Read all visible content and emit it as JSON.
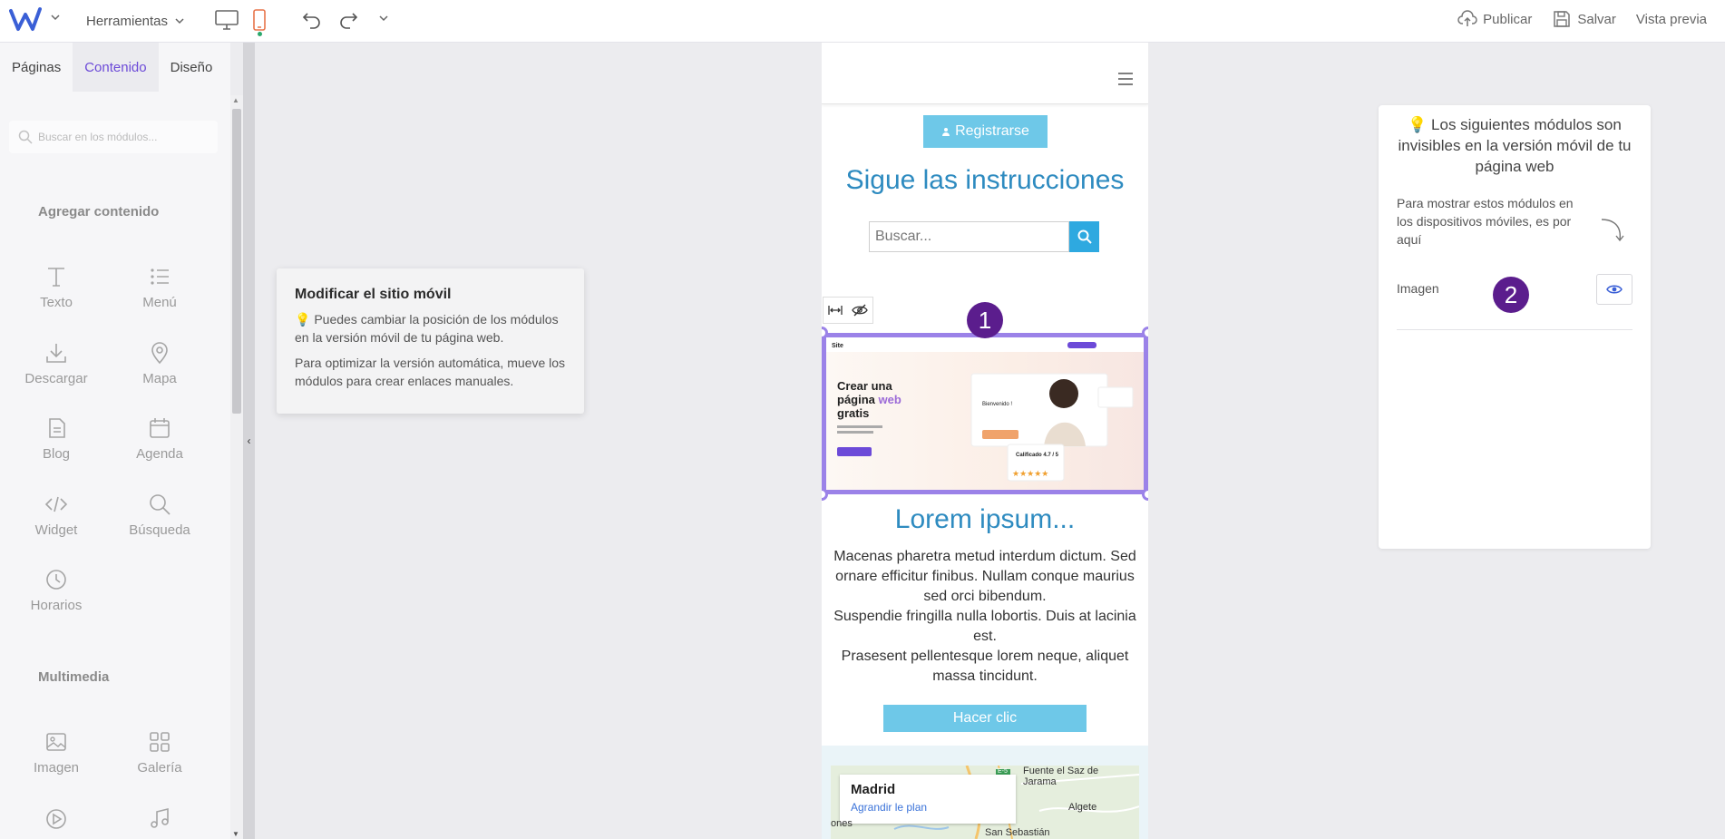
{
  "topbar": {
    "tools_label": "Herramientas",
    "publish_label": "Publicar",
    "save_label": "Salvar",
    "preview_label": "Vista previa"
  },
  "leftpanel": {
    "tabs": [
      "Páginas",
      "Contenido",
      "Diseño"
    ],
    "active_tab": "Contenido",
    "search_placeholder": "Buscar en los módulos...",
    "section_add": "Agregar contenido",
    "modules": [
      "Texto",
      "Menú",
      "Descargar",
      "Mapa",
      "Blog",
      "Agenda",
      "Widget",
      "Búsqueda",
      "Horarios"
    ],
    "section_multimedia": "Multimedia",
    "multimedia_modules": [
      "Imagen",
      "Galería"
    ]
  },
  "tip": {
    "title": "Modificar el sitio móvil",
    "text1": "Puedes cambiar la posición de los módulos en la versión móvil de tu página web.",
    "text2": "Para optimizar la versión automática, mueve los módulos para crear enlaces manuales."
  },
  "phone": {
    "register_label": "Registrarse",
    "follow_title": "Sigue las instrucciones",
    "search_placeholder": "Buscar...",
    "image_preview": {
      "headline_1": "Crear una",
      "headline_2a": "página ",
      "headline_2b": "web",
      "headline_3": "gratis",
      "card_welcome": "Bienvenido !",
      "card_rating": "Calificado 4.7 / 5"
    },
    "lorem_title": "Lorem ipsum...",
    "lorem_paragraphs": [
      "Macenas pharetra metud interdum dictum. Sed ornare efficitur finibus. Nullam conque maurius sed orci bibendum.",
      "Suspendie fringilla nulla lobortis. Duis at lacinia est.",
      "Prasesent pellentesque lorem neque, aliquet massa tincidunt."
    ],
    "click_label": "Hacer clic",
    "map": {
      "city": "Madrid",
      "link": "Agrandir le plan",
      "labels": [
        "Fuente el Saz de Jarama",
        "Algete",
        "San Sebastián",
        "ones",
        "E-5"
      ]
    }
  },
  "badges": [
    "1",
    "2"
  ],
  "right_panel": {
    "title": "Los siguientes módulos son invisibles en la versión móvil de tu página web",
    "description": "Para mostrar estos módulos en los dispositivos móviles, es por aquí",
    "hidden_module": "Imagen"
  },
  "colors": {
    "accent": "#6c4ad8",
    "heading_blue": "#2e8bc0",
    "button_blue": "#6ec8e8",
    "badge": "#5b1d8d",
    "selection": "#9b82e8"
  }
}
